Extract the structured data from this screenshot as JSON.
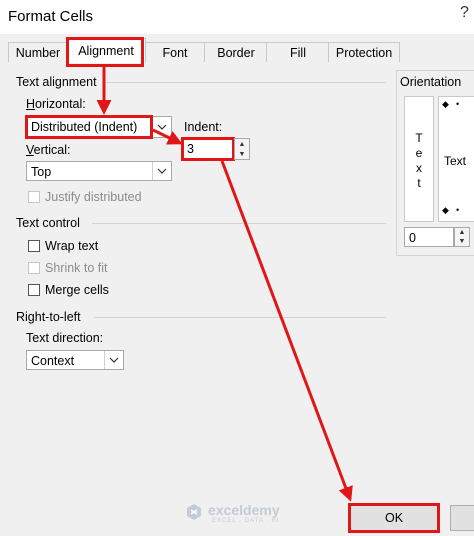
{
  "dialog": {
    "title": "Format Cells",
    "help": "?"
  },
  "tabs": [
    {
      "label": "Number"
    },
    {
      "label": "Alignment"
    },
    {
      "label": "Font"
    },
    {
      "label": "Border"
    },
    {
      "label": "Fill"
    },
    {
      "label": "Protection"
    }
  ],
  "text_alignment": {
    "heading": "Text alignment",
    "horizontal_label": "Horizontal:",
    "horizontal_value": "Distributed (Indent)",
    "indent_label": "Indent:",
    "indent_value": "3",
    "vertical_label": "Vertical:",
    "vertical_value": "Top",
    "justify_distributed": "Justify distributed"
  },
  "text_control": {
    "heading": "Text control",
    "wrap": "Wrap text",
    "shrink": "Shrink to fit",
    "merge": "Merge cells"
  },
  "rtl": {
    "heading": "Right-to-left",
    "direction_label": "Text direction:",
    "direction_value": "Context"
  },
  "orientation": {
    "heading": "Orientation",
    "vertical_text": [
      "T",
      "e",
      "x",
      "t"
    ],
    "text_label": "Text",
    "degrees_value": "0"
  },
  "watermark": {
    "name": "exceldemy",
    "tagline": "EXCEL · DATA · BI"
  },
  "buttons": {
    "ok": "OK"
  },
  "colors": {
    "highlight": "#e01717",
    "watermark": "#c3ccd6"
  }
}
